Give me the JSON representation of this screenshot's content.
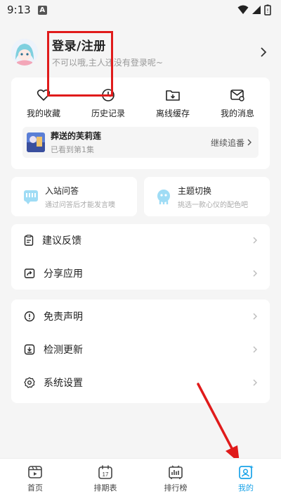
{
  "status_bar": {
    "time": "9:13",
    "notification_badge": "A"
  },
  "profile": {
    "title": "登录/注册",
    "subtitle": "不可以哦,主人还没有登录呢~"
  },
  "quick_actions": [
    {
      "label": "我的收藏",
      "icon": "heart-icon"
    },
    {
      "label": "历史记录",
      "icon": "history-icon"
    },
    {
      "label": "离线缓存",
      "icon": "download-folder-icon"
    },
    {
      "label": "我的消息",
      "icon": "message-icon"
    }
  ],
  "history": {
    "title": "葬送的芙莉莲",
    "progress": "已看到第1集",
    "continue_label": "继续追番"
  },
  "feature_cards": [
    {
      "title": "入站问答",
      "subtitle": "通过问答后才能发言噢",
      "icon": "quiz-icon"
    },
    {
      "title": "主题切换",
      "subtitle": "挑选一款心仪的配色吧",
      "icon": "theme-icon"
    }
  ],
  "menu_group_1": [
    {
      "label": "建议反馈",
      "icon": "feedback-icon"
    },
    {
      "label": "分享应用",
      "icon": "share-icon"
    }
  ],
  "menu_group_2": [
    {
      "label": "免责声明",
      "icon": "info-icon"
    },
    {
      "label": "检测更新",
      "icon": "update-icon"
    },
    {
      "label": "系统设置",
      "icon": "settings-icon"
    }
  ],
  "bottom_nav": [
    {
      "label": "首页",
      "icon": "home-icon"
    },
    {
      "label": "排期表",
      "icon": "calendar-icon",
      "calendar_day": "17"
    },
    {
      "label": "排行榜",
      "icon": "ranking-icon"
    },
    {
      "label": "我的",
      "icon": "profile-icon",
      "active": true
    }
  ],
  "colors": {
    "accent": "#1aa3e8",
    "annotation": "#e01b1b",
    "background": "#f5f5f5"
  }
}
